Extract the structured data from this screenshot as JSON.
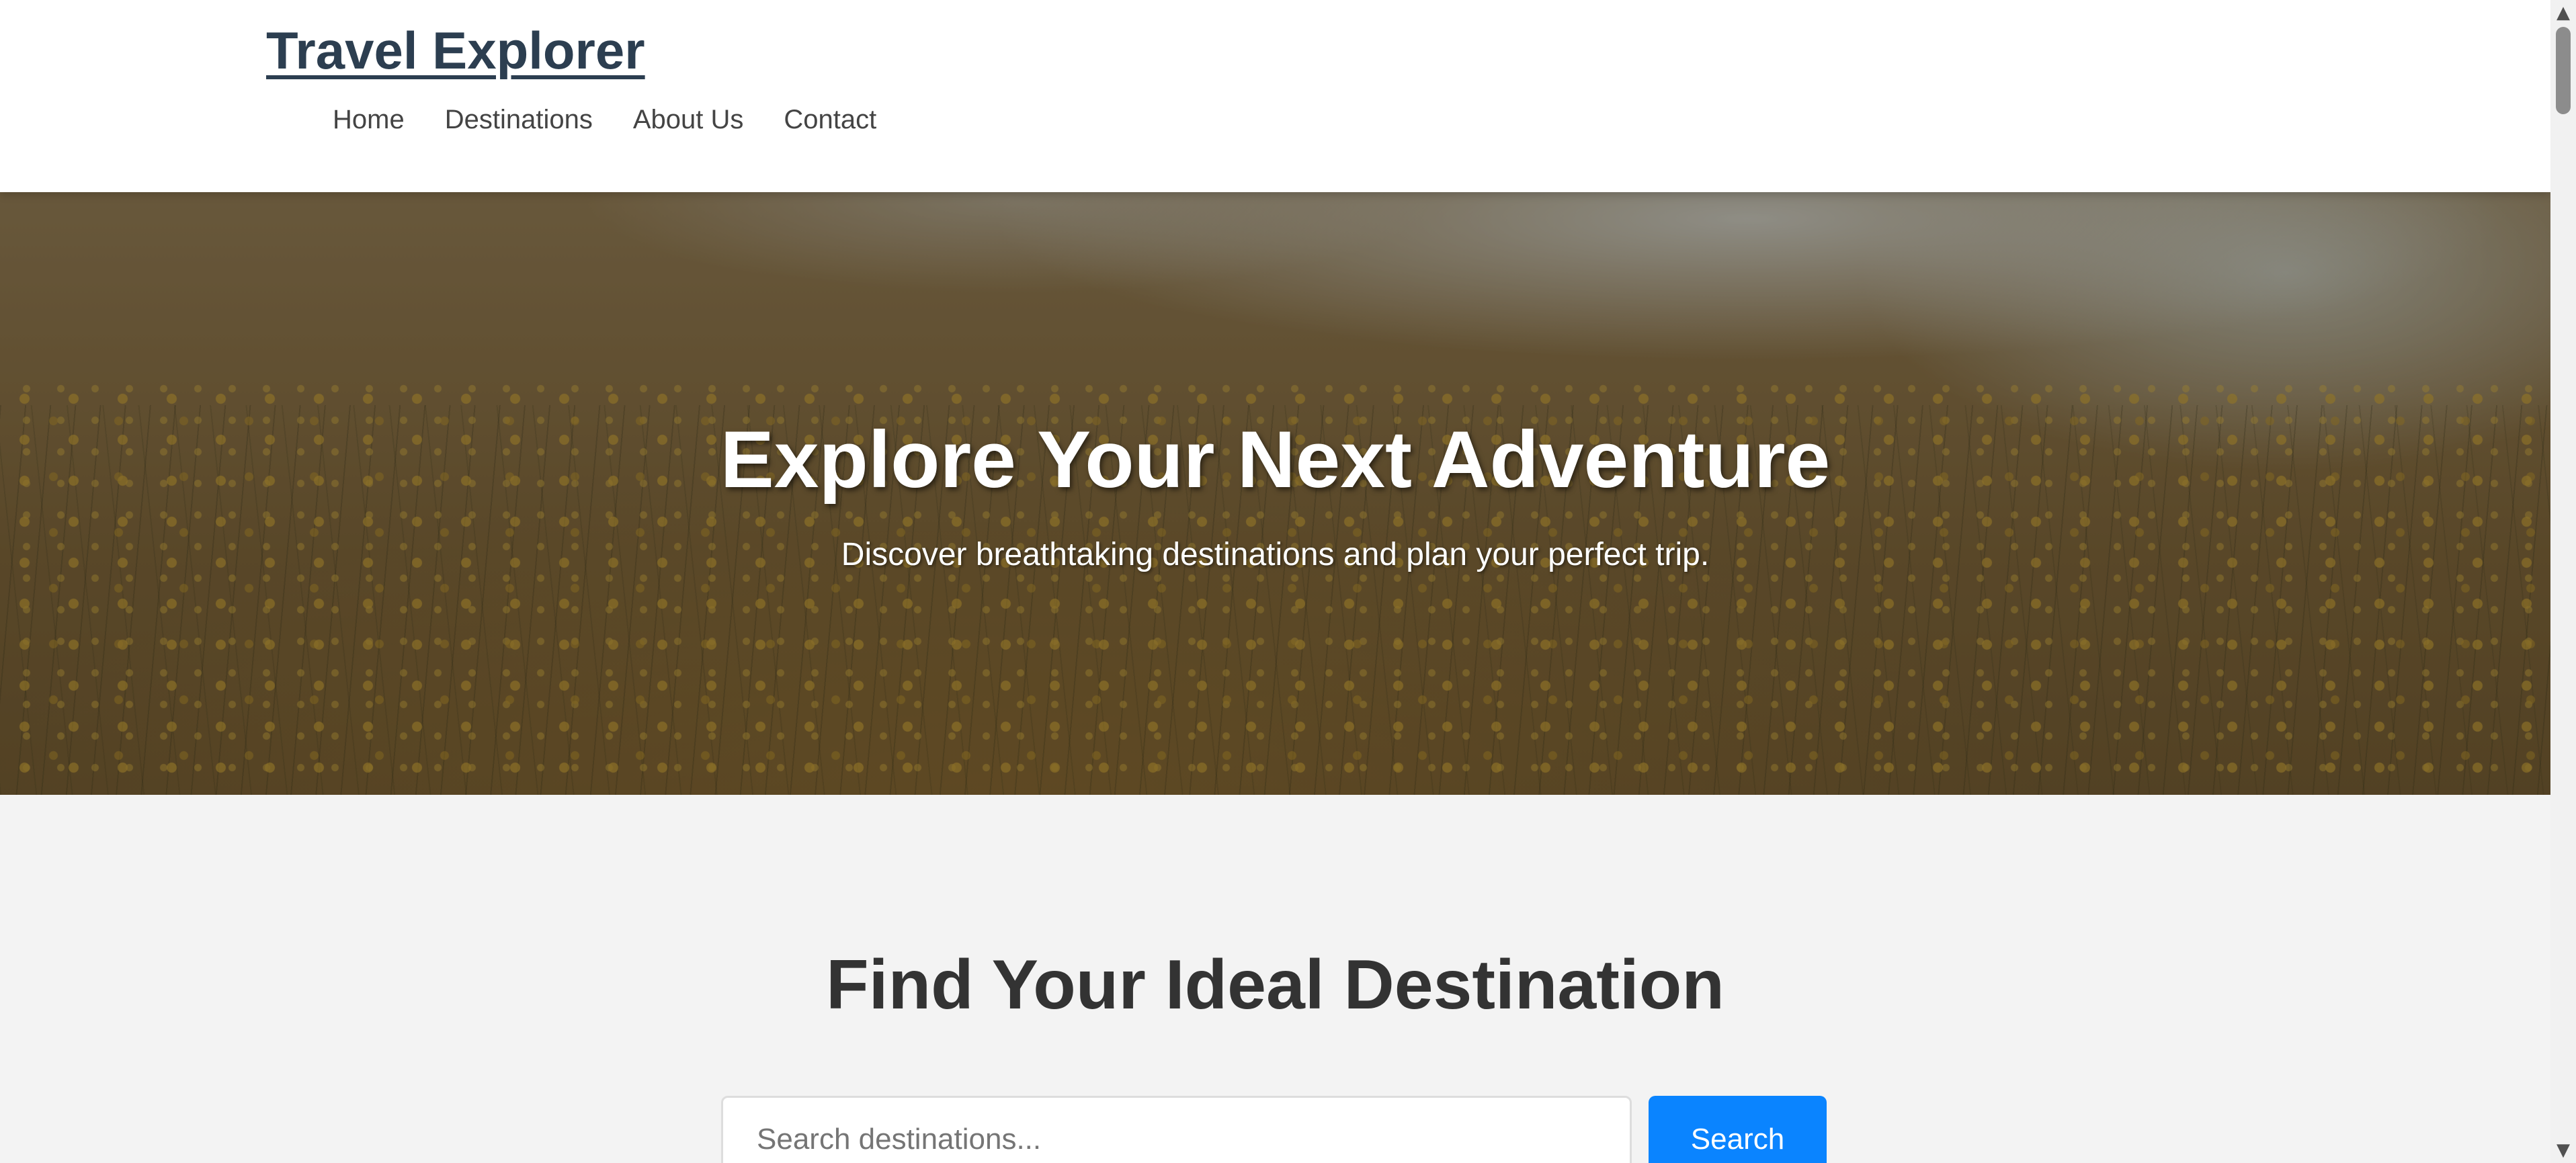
{
  "header": {
    "logo": "Travel Explorer",
    "nav": [
      {
        "label": "Home"
      },
      {
        "label": "Destinations"
      },
      {
        "label": "About Us"
      },
      {
        "label": "Contact"
      }
    ]
  },
  "hero": {
    "title": "Explore Your Next Adventure",
    "subtitle": "Discover breathtaking destinations and plan your perfect trip."
  },
  "search": {
    "title": "Find Your Ideal Destination",
    "placeholder": "Search destinations...",
    "button_label": "Search"
  },
  "colors": {
    "logo": "#2c3e50",
    "accent": "#0a84ff",
    "section_bg": "#f3f3f3"
  },
  "scrollbar": {
    "up_icon": "triangle-up",
    "down_icon": "triangle-down"
  }
}
